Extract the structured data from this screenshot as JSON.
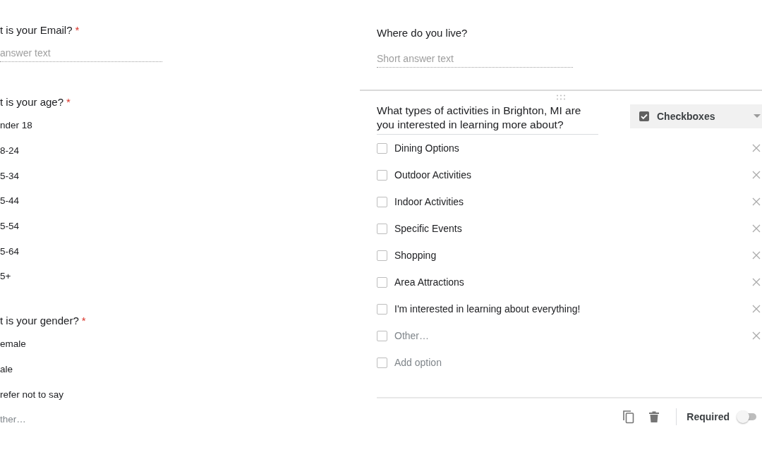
{
  "required_mark": "*",
  "left_questions": [
    {
      "title": "t is your Email?",
      "required": true,
      "kind": "short",
      "placeholder": "answer text"
    },
    {
      "title": "t is your age?",
      "required": true,
      "kind": "choice",
      "options": [
        {
          "label": "nder 18",
          "kind": "option"
        },
        {
          "label": "8-24",
          "kind": "option"
        },
        {
          "label": "5-34",
          "kind": "option"
        },
        {
          "label": "5-44",
          "kind": "option"
        },
        {
          "label": "5-54",
          "kind": "option"
        },
        {
          "label": "5-64",
          "kind": "option"
        },
        {
          "label": "5+",
          "kind": "option"
        }
      ]
    },
    {
      "title": "t is your gender?",
      "required": true,
      "kind": "choice",
      "options": [
        {
          "label": "emale",
          "kind": "option"
        },
        {
          "label": "ale",
          "kind": "option"
        },
        {
          "label": "refer not to say",
          "kind": "option"
        },
        {
          "label": "ther…",
          "kind": "other"
        }
      ]
    }
  ],
  "where_question": {
    "title": "Where do you live?",
    "placeholder": "Short answer text"
  },
  "active_question": {
    "title": "What types of activities in Brighton, MI are you interested in learning more about?",
    "type_label": "Checkboxes",
    "options": [
      {
        "label": "Dining Options",
        "kind": "option",
        "checked": false
      },
      {
        "label": "Outdoor Activities",
        "kind": "option",
        "checked": false
      },
      {
        "label": "Indoor Activities",
        "kind": "option",
        "checked": false
      },
      {
        "label": "Specific Events",
        "kind": "option",
        "checked": false
      },
      {
        "label": "Shopping",
        "kind": "option",
        "checked": false
      },
      {
        "label": "Area Attractions",
        "kind": "option",
        "checked": false
      },
      {
        "label": "I'm interested in learning about everything!",
        "kind": "option",
        "checked": false
      },
      {
        "label": "Other…",
        "kind": "other",
        "checked": false
      },
      {
        "label": "Add option",
        "kind": "add",
        "checked": false
      }
    ],
    "required_label": "Required",
    "required_on": false
  }
}
